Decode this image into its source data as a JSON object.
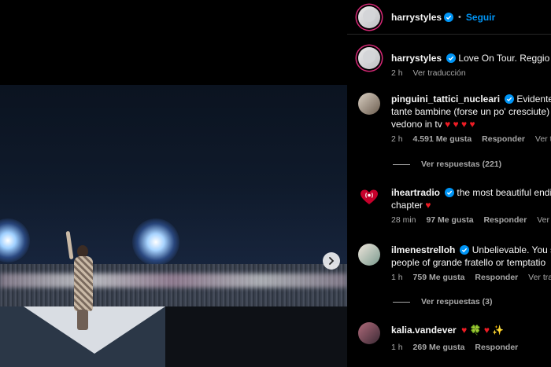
{
  "post": {
    "username": "harrystyles",
    "follow_label": "Seguir",
    "dot": "•"
  },
  "caption": {
    "username": "harrystyles",
    "text": "Love On Tour. Reggio Em",
    "time": "2 h",
    "translate": "Ver traducción"
  },
  "comments": [
    {
      "username": "pinguini_tattici_nucleari",
      "line1": "Evidentem",
      "line2": "tante bambine (forse un po' cresciute)",
      "line3": "vedono in tv",
      "hearts": "♥ ♥ ♥ ♥",
      "time": "2 h",
      "likes": "4.591 Me gusta",
      "reply": "Responder",
      "translate": "Ver trad",
      "view_replies": "Ver respuestas (221)"
    },
    {
      "username": "iheartradio",
      "line1": "the most beautiful endi",
      "line2": "chapter",
      "hearts": "♥",
      "time": "28 min",
      "likes": "97 Me gusta",
      "reply": "Responder",
      "translate": "Ver tra"
    },
    {
      "username": "ilmenestrelloh",
      "line1": "Unbelievable. You sp",
      "line2": "people of grande fratello or temptatio",
      "time": "1 h",
      "likes": "759 Me gusta",
      "reply": "Responder",
      "translate": "Ver tradu",
      "view_replies": "Ver respuestas (3)"
    },
    {
      "username": "kalia.vandever",
      "emojis": "♥ 🍀 ♥ ✨",
      "time": "1 h",
      "likes": "269 Me gusta",
      "reply": "Responder"
    }
  ],
  "colors": {
    "accent": "#0095f6",
    "verified": "#0095f6",
    "heart": "#ed1c24",
    "muted": "#a8a8a8"
  }
}
